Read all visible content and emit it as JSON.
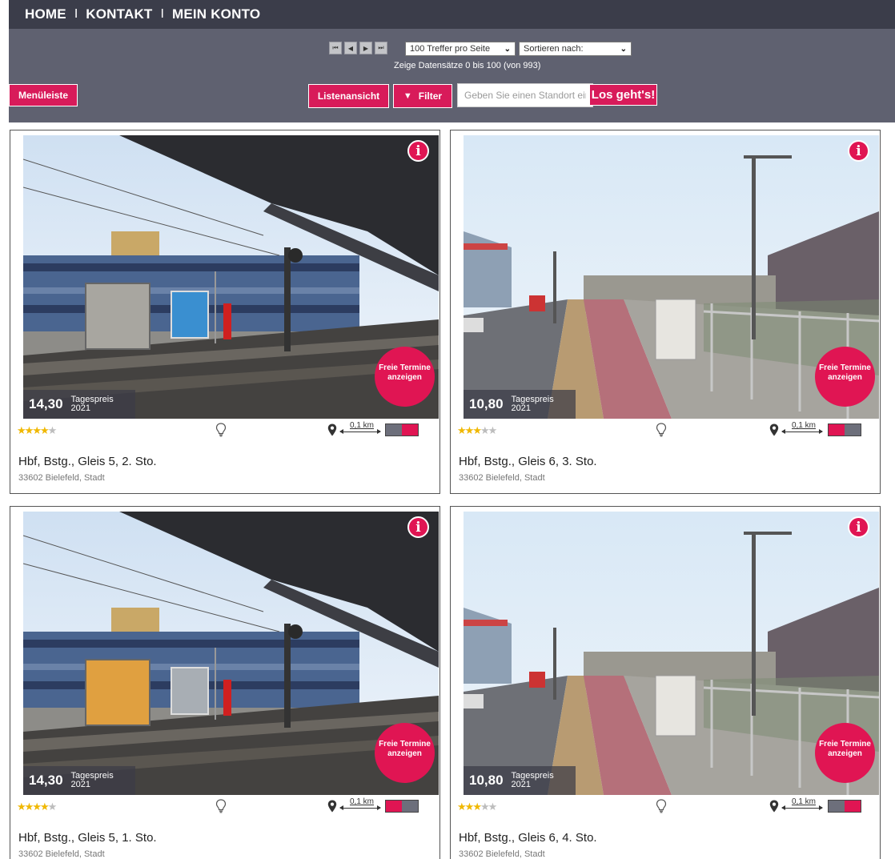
{
  "nav": {
    "items": [
      "HOME",
      "KONTAKT",
      "MEIN KONTO"
    ],
    "separator": "I"
  },
  "toolbar": {
    "per_page": "100 Treffer pro Seite",
    "sort": "Sortieren nach:",
    "records_info": "Zeige Datensätze 0 bis 100 (von 993)",
    "menu_button": "Menüleiste",
    "list_button": "Listenansicht",
    "filter_button": "Filter",
    "search_placeholder": "Geben Sie einen Standort ein",
    "go_button": "Los geht's!"
  },
  "common": {
    "info_symbol": "i",
    "termine_line1": "Freie Termine",
    "termine_line2": "anzeigen",
    "price_label": "Tagespreis",
    "price_year": "2021",
    "distance": "0,1 km"
  },
  "cards": [
    {
      "price": "14,30",
      "rating": 3.5,
      "title": "Hbf, Bstg., Gleis 5, 2. Sto.",
      "location": "33602 Bielefeld, Stadt",
      "facing": "right",
      "scene": "platform",
      "ad_left": "#a8a6a0",
      "ad_right": "#3a8fd0"
    },
    {
      "price": "10,80",
      "rating": 3,
      "title": "Hbf, Bstg., Gleis 6, 3. Sto.",
      "location": "33602 Bielefeld, Stadt",
      "facing": "left",
      "scene": "street"
    },
    {
      "price": "14,30",
      "rating": 3.5,
      "title": "Hbf, Bstg., Gleis 5, 1. Sto.",
      "location": "33602 Bielefeld, Stadt",
      "facing": "left",
      "scene": "platform",
      "ad_left": "#e0a040",
      "ad_right": "#a8aeb4"
    },
    {
      "price": "10,80",
      "rating": 3,
      "title": "Hbf, Bstg., Gleis 6, 4. Sto.",
      "location": "33602 Bielefeld, Stadt",
      "facing": "right",
      "scene": "street"
    }
  ],
  "colors": {
    "accent": "#d81b5a",
    "nav_bg": "#3b3d4a",
    "toolbar_bg": "#5f6170"
  }
}
